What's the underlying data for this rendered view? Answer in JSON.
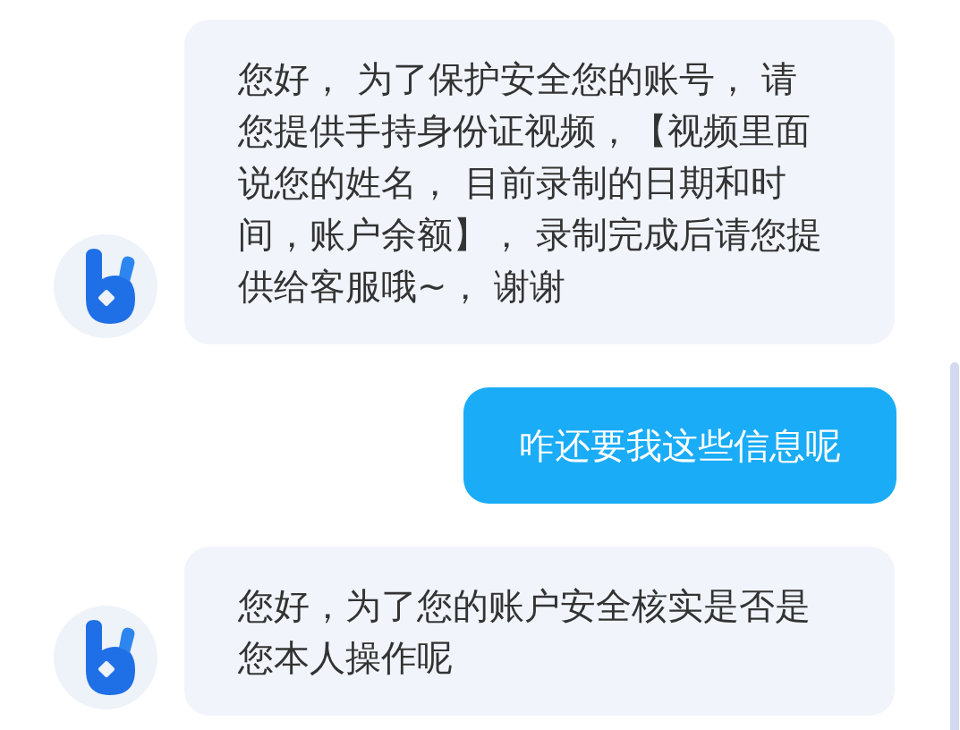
{
  "messages": [
    {
      "kind": "agent",
      "text": "您好， 为了保护安全您的账号， 请您提供手持身份证视频，【视频里面说您的姓名， 目前录制的日期和时间，账户余额】， 录制完成后请您提供给客服哦~， 谢谢"
    },
    {
      "kind": "user",
      "text": "咋还要我这些信息呢"
    },
    {
      "kind": "agent",
      "text": "您好，为了您的账户安全核实是否是您本人操作呢"
    }
  ]
}
